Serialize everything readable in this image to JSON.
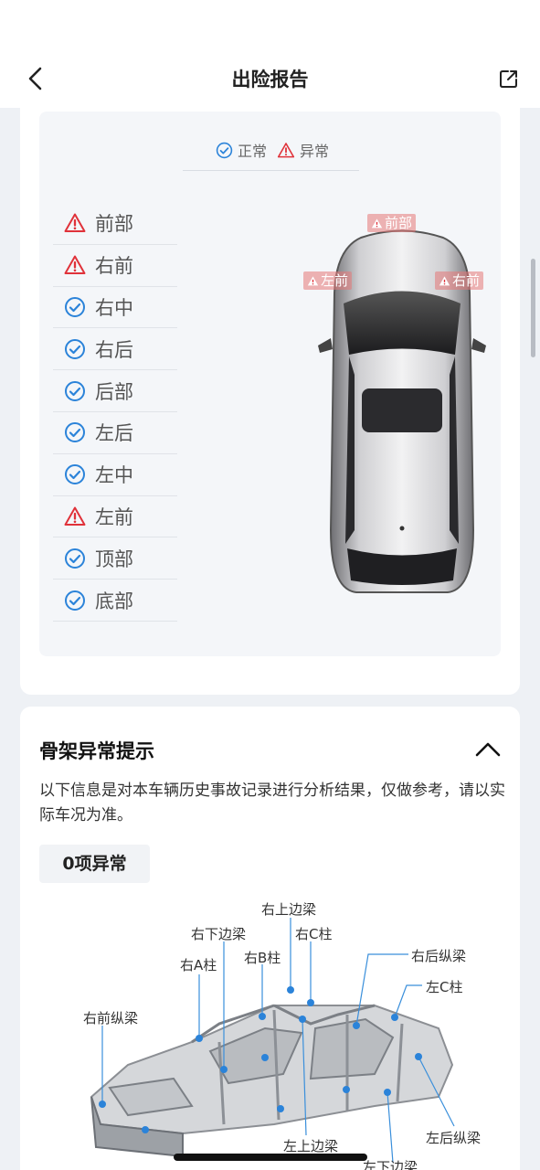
{
  "header": {
    "title": "出险报告",
    "back_icon": "chevron-left-icon",
    "share_icon": "share-icon"
  },
  "legend": {
    "normal_label": "正常",
    "abnormal_label": "异常",
    "normal_color": "#2b83d9",
    "abnormal_color": "#e0323a"
  },
  "parts": [
    {
      "label": "前部",
      "status": "abnormal"
    },
    {
      "label": "右前",
      "status": "abnormal"
    },
    {
      "label": "右中",
      "status": "normal"
    },
    {
      "label": "右后",
      "status": "normal"
    },
    {
      "label": "后部",
      "status": "normal"
    },
    {
      "label": "左后",
      "status": "normal"
    },
    {
      "label": "左中",
      "status": "normal"
    },
    {
      "label": "左前",
      "status": "abnormal"
    },
    {
      "label": "顶部",
      "status": "normal"
    },
    {
      "label": "底部",
      "status": "normal"
    }
  ],
  "car_tags": {
    "front": "前部",
    "left_front": "左前",
    "right_front": "右前"
  },
  "skeleton": {
    "title": "骨架异常提示",
    "description": "以下信息是对本车辆历史事故记录进行分析结果，仅做参考，请以实际车况为准。",
    "count_label": "0项异常",
    "labels": {
      "right_upper_beam": "右上边梁",
      "right_lower_beam": "右下边梁",
      "right_c_pillar": "右C柱",
      "right_rear_rail": "右后纵梁",
      "right_a_pillar": "右A柱",
      "right_b_pillar": "右B柱",
      "left_c_pillar": "左C柱",
      "right_front_rail": "右前纵梁",
      "left_rear_rail": "左后纵梁",
      "left_upper_beam": "左上边梁",
      "left_lower_beam": "左下边梁"
    }
  }
}
